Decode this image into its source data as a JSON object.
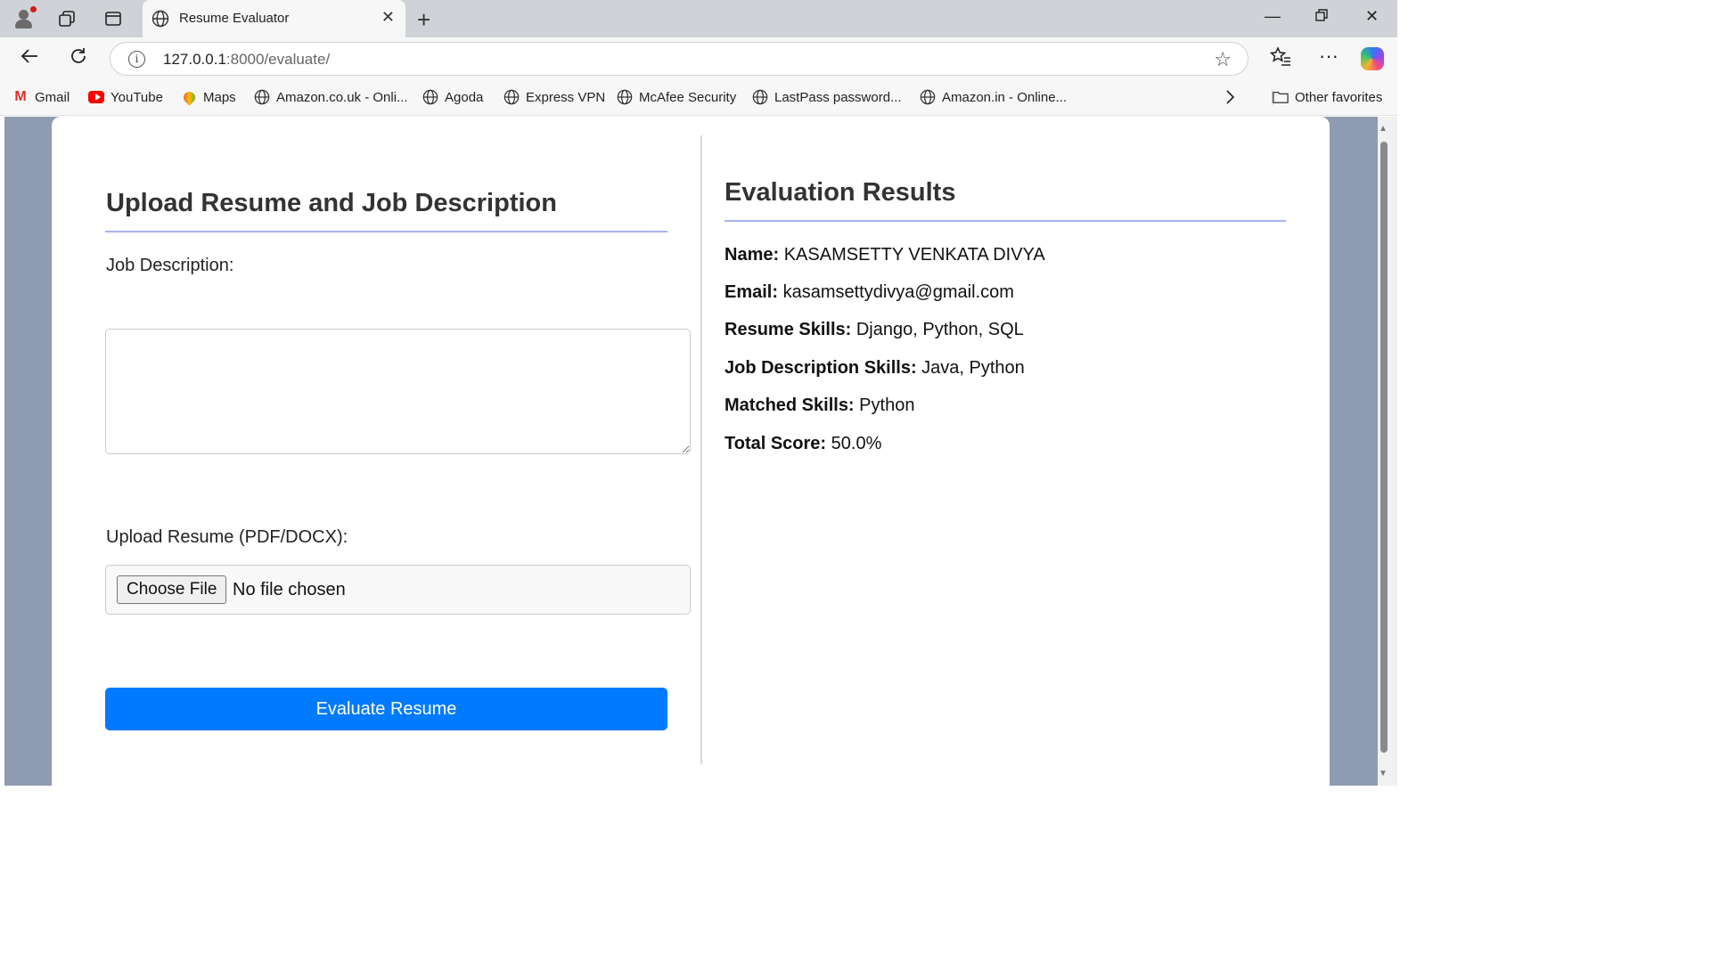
{
  "browser": {
    "tab_title": "Resume Evaluator",
    "url_host": "127.0.0.1",
    "url_path": ":8000/evaluate/",
    "bookmarks": [
      "Gmail",
      "YouTube",
      "Maps",
      "Amazon.co.uk - Onli...",
      "Agoda",
      "Express VPN",
      "McAfee Security",
      "LastPass password...",
      "Amazon.in - Online..."
    ],
    "other_favorites": "Other favorites"
  },
  "form": {
    "heading": "Upload Resume and Job Description",
    "job_description_label": "Job Description:",
    "job_description_value": "",
    "upload_label": "Upload Resume (PDF/DOCX):",
    "choose_file_label": "Choose File",
    "file_status": "No file chosen",
    "submit_label": "Evaluate Resume"
  },
  "results": {
    "heading": "Evaluation Results",
    "items": [
      {
        "label": "Name:",
        "value": "KASAMSETTY VENKATA DIVYA"
      },
      {
        "label": "Email:",
        "value": "kasamsettydivya@gmail.com"
      },
      {
        "label": "Resume Skills:",
        "value": "Django, Python, SQL"
      },
      {
        "label": "Job Description Skills:",
        "value": "Java, Python"
      },
      {
        "label": "Matched Skills:",
        "value": "Python"
      },
      {
        "label": "Total Score:",
        "value": "50.0%"
      }
    ]
  },
  "colors": {
    "accent": "#007bff",
    "heading_underline": "#a8b4ee",
    "page_background": "#8f9bb3"
  }
}
